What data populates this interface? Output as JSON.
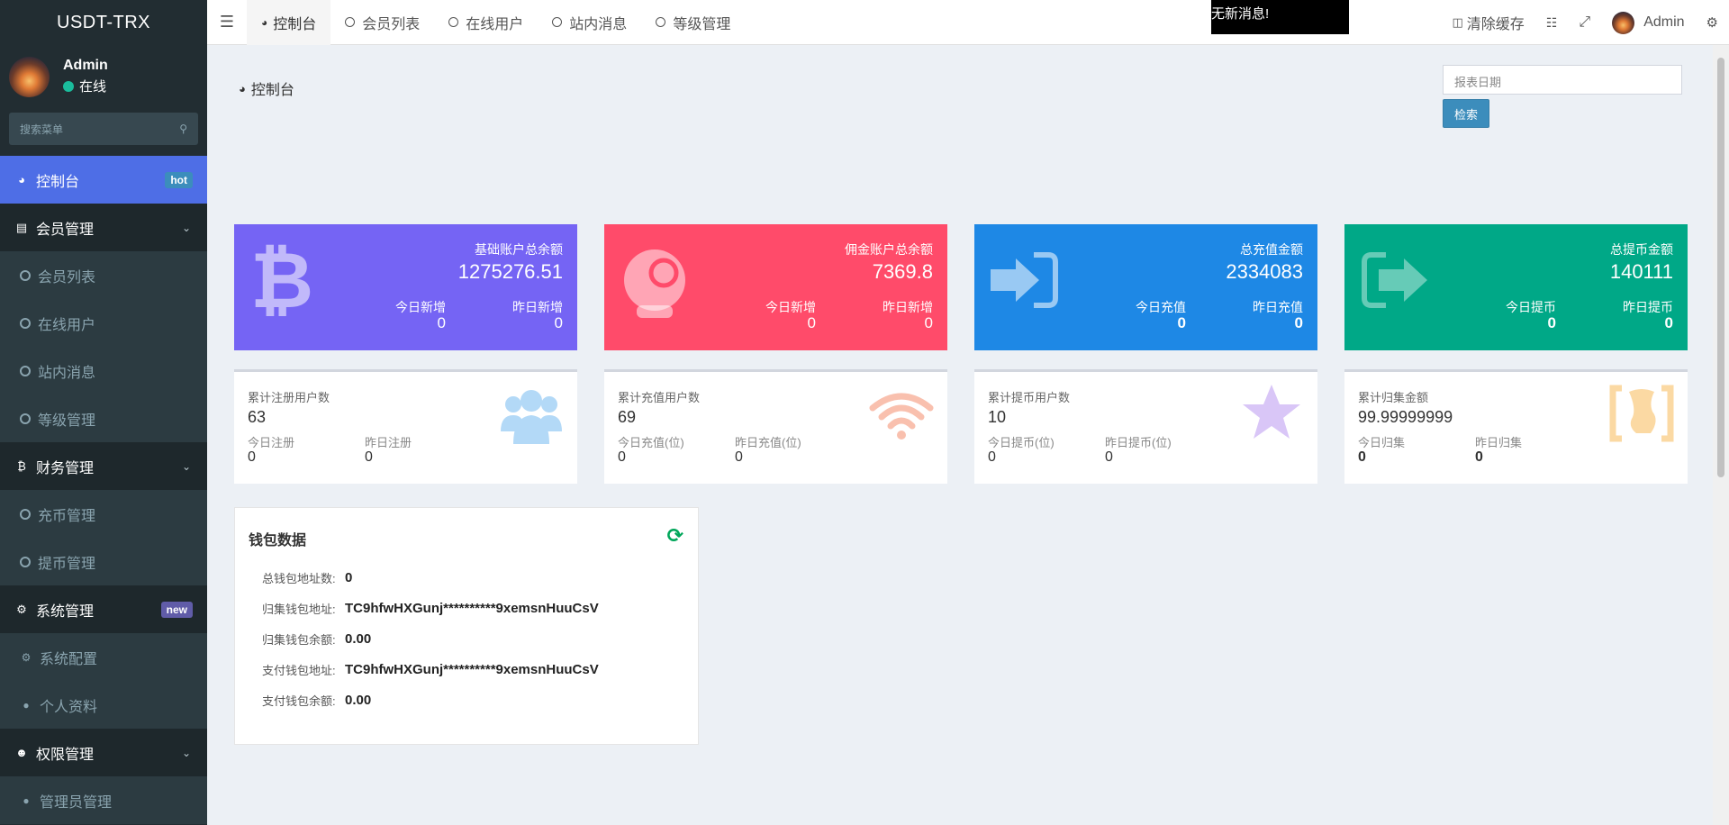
{
  "brand": "USDT-TRX",
  "user": {
    "name": "Admin",
    "status": "在线"
  },
  "sidebar_search_placeholder": "搜索菜单",
  "menu": {
    "dashboard": {
      "label": "控制台",
      "badge": "hot"
    },
    "member": {
      "label": "会员管理",
      "items": [
        "会员列表",
        "在线用户",
        "站内消息",
        "等级管理"
      ]
    },
    "finance": {
      "label": "财务管理",
      "items": [
        "充币管理",
        "提币管理"
      ]
    },
    "system": {
      "label": "系统管理",
      "badge": "new",
      "items": [
        "系统配置",
        "个人资料"
      ]
    },
    "permission": {
      "label": "权限管理",
      "items": [
        "管理员管理"
      ]
    }
  },
  "tabs": [
    "控制台",
    "会员列表",
    "在线用户",
    "站内消息",
    "等级管理"
  ],
  "notice": "无新消息!",
  "topbar": {
    "clear_cache": "清除缓存",
    "admin": "Admin"
  },
  "page_title": "控制台",
  "date_placeholder": "报表日期",
  "search_button": "检索",
  "stat_cards": [
    {
      "title": "基础账户总余额",
      "value": "1275276.51",
      "sub1_label": "今日新增",
      "sub1_value": "0",
      "sub2_label": "昨日新增",
      "sub2_value": "0",
      "color": "#7564f4"
    },
    {
      "title": "佣金账户总余额",
      "value": "7369.8",
      "sub1_label": "今日新增",
      "sub1_value": "0",
      "sub2_label": "昨日新增",
      "sub2_value": "0",
      "color": "#ff4b6a"
    },
    {
      "title": "总充值金额",
      "value": "2334083",
      "sub1_label": "今日充值",
      "sub1_value": "0",
      "sub2_label": "昨日充值",
      "sub2_value": "0",
      "color": "#1e88e5"
    },
    {
      "title": "总提币金额",
      "value": "140111",
      "sub1_label": "今日提币",
      "sub1_value": "0",
      "sub2_label": "昨日提币",
      "sub2_value": "0",
      "color": "#00a887"
    }
  ],
  "info_cards": [
    {
      "title": "累计注册用户数",
      "value": "63",
      "sub1_label": "今日注册",
      "sub1_value": "0",
      "sub2_label": "昨日注册",
      "sub2_value": "0"
    },
    {
      "title": "累计充值用户数",
      "value": "69",
      "sub1_label": "今日充值(位)",
      "sub1_value": "0",
      "sub2_label": "昨日充值(位)",
      "sub2_value": "0"
    },
    {
      "title": "累计提币用户数",
      "value": "10",
      "sub1_label": "今日提币(位)",
      "sub1_value": "0",
      "sub2_label": "昨日提币(位)",
      "sub2_value": "0"
    },
    {
      "title": "累计归集金额",
      "value": "99.99999999",
      "sub1_label": "今日归集",
      "sub1_value": "0",
      "sub2_label": "昨日归集",
      "sub2_value": "0"
    }
  ],
  "wallet": {
    "title": "钱包数据",
    "rows": [
      {
        "label": "总钱包地址数:",
        "value": "0"
      },
      {
        "label": "归集钱包地址:",
        "value": "TC9hfwHXGunj**********9xemsnHuuCsV"
      },
      {
        "label": "归集钱包余额:",
        "value": "0.00"
      },
      {
        "label": "支付钱包地址:",
        "value": "TC9hfwHXGunj**********9xemsnHuuCsV"
      },
      {
        "label": "支付钱包余额:",
        "value": "0.00"
      }
    ]
  }
}
